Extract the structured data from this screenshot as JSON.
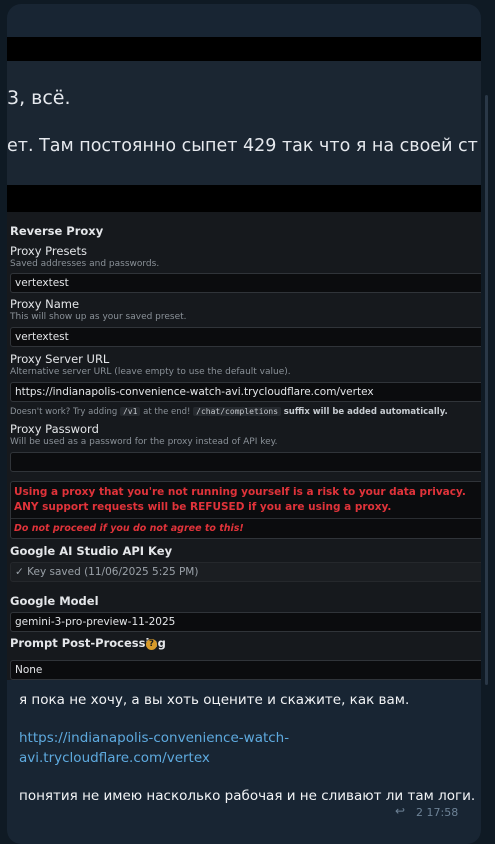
{
  "screenshot": {
    "banner": {
      "line1": "3, всё.",
      "line2": "ет. Там постоянно сыпет 429 так что я на своей ст"
    },
    "settings": {
      "section_title": "Reverse Proxy",
      "presets": {
        "label": "Proxy Presets",
        "hint": "Saved addresses and passwords.",
        "value": "vertextest"
      },
      "proxy_name": {
        "label": "Proxy Name",
        "hint": "This will show up as your saved preset.",
        "value": "vertextest"
      },
      "server_url": {
        "label": "Proxy Server URL",
        "hint": "Alternative server URL (leave empty to use the default value).",
        "value": "https://indianapolis-convenience-watch-avi.trycloudflare.com/vertex",
        "note_prefix": "Doesn't work? Try adding",
        "note_code1": "/v1",
        "note_middle": "at the end!",
        "note_code2": "/chat/completions",
        "note_suffix": "suffix will be added automatically."
      },
      "password": {
        "label": "Proxy Password",
        "hint": "Will be used as a password for the proxy instead of API key.",
        "value": ""
      },
      "warning": {
        "line1": "Using a proxy that you're not running yourself is a risk to your data privacy.",
        "line2": "ANY support requests will be REFUSED if you are using a proxy.",
        "line3": "Do not proceed if you do not agree to this!"
      },
      "api_key": {
        "label": "Google AI Studio API Key",
        "value": "✓ Key saved (11/06/2025 5:25 PM)"
      },
      "model": {
        "label": "Google Model",
        "value": "gemini-3-pro-preview-11-2025"
      },
      "post_processing": {
        "label": "Prompt Post-Processing",
        "help_icon": "?",
        "value": "None"
      }
    }
  },
  "message": {
    "text1": "я пока не хочу, а вы хоть оцените  и скажите, как вам.",
    "link_line1": "https://indianapolis-convenience-watch-",
    "link_line2": "avi.trycloudflare.com/vertex",
    "text2": "понятия не имею насколько рабочая и не сливают ли там логи.",
    "time": "2  17:58",
    "reply_icon": "↩"
  }
}
